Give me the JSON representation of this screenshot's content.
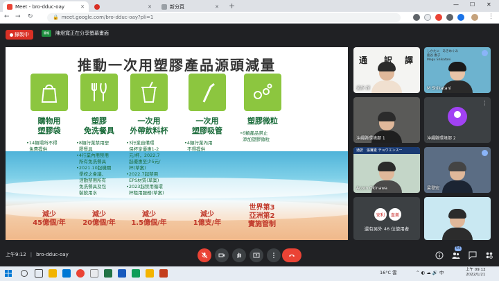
{
  "browser": {
    "tabs": [
      {
        "title": "Meet - bro-dduc-oay",
        "active": true
      },
      {
        "title": "",
        "active": false
      },
      {
        "title": "新分頁",
        "active": false
      }
    ],
    "url": "meet.google.com/bro-dduc-oay?pli=1",
    "new_tab": "+"
  },
  "meet": {
    "recording_label": "錄製中",
    "presenter_text": "陳燈寬正在分享螢幕畫面",
    "presenter_chip": "簡報"
  },
  "slide": {
    "title": "推動一次用塑膠產品源頭減量",
    "categories": [
      {
        "label": "購物用\n塑膠袋",
        "icon": "shopping-bag-icon",
        "details": "•14類場所不得\n  免費提供",
        "reduce": "減少\n45億個/年"
      },
      {
        "label": "塑膠\n免洗餐具",
        "icon": "cutlery-icon",
        "details": "•8類行業禁用塑\n  膠餐具\n•4行業內用禁用\n  所有免洗餐具\n•2021.10起機關\n  學校之會議、\n  活動禁用所有\n  免洗餐具及包\n  裝飲用水",
        "reduce": "減少\n20億個/年"
      },
      {
        "label": "一次用\n外帶飲料杯",
        "icon": "drink-cup-icon",
        "details": "•3行業自備環\n  保杯享優惠1-2\n  元/杯，2022.7\n  起優惠至少5元/\n  杯(草案)\n•2022.7起禁用\n  EPS材質(草案)\n•2023起禁用循環\n  杯租用服務(草案)",
        "reduce": "減少\n1.5億個/年"
      },
      {
        "label": "一次用\n塑膠吸管",
        "icon": "straw-icon",
        "details": "•4類行業內用\n  不得提供",
        "reduce": "減少\n1億支/年"
      },
      {
        "label": "塑膠微粒",
        "icon": "microbeads-icon",
        "details": "•6類產品禁止\n  添加塑膠微粒",
        "reduce": "世界第3\n亞洲第2\n實施管制"
      }
    ]
  },
  "participants": [
    {
      "name": "通訳 譯",
      "overlay": "通　　訳",
      "overlay2": "譯"
    },
    {
      "name": "M Shikatani",
      "overlay": "しかたに　あきめぐみ\n鹿谷 惠子\nMegu Shikatani"
    },
    {
      "name": "沖繩縣環境部 1",
      "overlay": ""
    },
    {
      "name": "沖繩縣環境部 2",
      "overlay": ""
    },
    {
      "name": "Acorn Okinawa",
      "overlay": "通訳　張賽素 チョウエンスー"
    },
    {
      "name": "梁發宏",
      "overlay": ""
    },
    {
      "name": "",
      "overlay": ""
    }
  ],
  "others": {
    "badge1": "安利",
    "badge2": "直美",
    "text": "還有另外 46 位使用者"
  },
  "bottom": {
    "time": "上午9:12",
    "meeting_code": "bro-dduc-oay",
    "participant_count": "54"
  },
  "taskbar": {
    "weather": "16°C 雲",
    "time": "上午 09:12",
    "date": "2022/1/21"
  },
  "colors": {
    "green_tile": "#8cc63f",
    "label_green": "#1a6b3a",
    "reduce_red": "#c0392b",
    "rec_red": "#d93025",
    "meet_bg": "#202124"
  }
}
